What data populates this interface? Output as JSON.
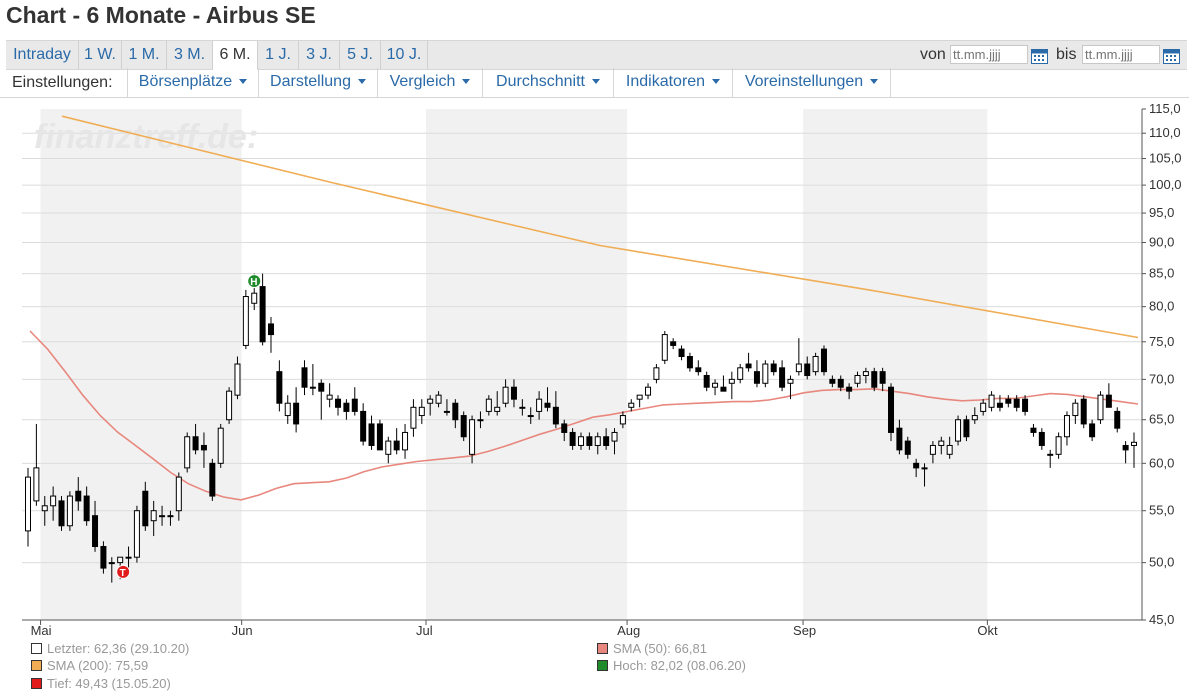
{
  "page": {
    "title": "Chart - 6 Monate - Airbus SE"
  },
  "tabs": [
    {
      "label": "Intraday"
    },
    {
      "label": "1 W."
    },
    {
      "label": "1 M."
    },
    {
      "label": "3 M."
    },
    {
      "label": "6 M.",
      "active": true
    },
    {
      "label": "1 J."
    },
    {
      "label": "3 J."
    },
    {
      "label": "5 J."
    },
    {
      "label": "10 J."
    }
  ],
  "date_range": {
    "from_label": "von",
    "from_placeholder": "tt.mm.jjjj",
    "to_label": "bis",
    "to_placeholder": "tt.mm.jjjj"
  },
  "settings": {
    "label": "Einstellungen:",
    "menus": [
      {
        "label": "Börsenplätze"
      },
      {
        "label": "Darstellung"
      },
      {
        "label": "Vergleich"
      },
      {
        "label": "Durchschnitt"
      },
      {
        "label": "Indikatoren"
      },
      {
        "label": "Voreinstellungen"
      }
    ]
  },
  "watermark": "finanztreff.de:",
  "colors": {
    "candle_up": "#ffffff",
    "candle_down": "#000000",
    "sma50": "#e8877d",
    "sma200": "#f0ad55",
    "band": "#f1f1f1",
    "grid": "#dcdcdc",
    "tab_link": "#2a6aa8",
    "marker_high": "#1f8b2b",
    "marker_low": "#e11b1b"
  },
  "chart_data": {
    "type": "candlestick",
    "y_scale": "log",
    "ylim": [
      45.0,
      115.0
    ],
    "y_ticks": [
      "115,0",
      "110,0",
      "105,0",
      "100,0",
      "95,0",
      "90,0",
      "85,0",
      "80,0",
      "75,0",
      "70,0",
      "65,0",
      "60,0",
      "55,0",
      "50,0",
      "45,0"
    ],
    "x_labels": [
      "Mai",
      "Jun",
      "Jul",
      "Aug",
      "Sep",
      "Okt"
    ],
    "candles": [
      {
        "o": 53.0,
        "h": 59.5,
        "l": 51.5,
        "c": 58.5
      },
      {
        "o": 56.0,
        "h": 64.5,
        "l": 55.5,
        "c": 59.5
      },
      {
        "o": 55.0,
        "h": 56.5,
        "l": 53.5,
        "c": 55.5
      },
      {
        "o": 55.5,
        "h": 57.5,
        "l": 54.0,
        "c": 56.5
      },
      {
        "o": 56.0,
        "h": 56.5,
        "l": 53.0,
        "c": 53.5
      },
      {
        "o": 53.5,
        "h": 57.0,
        "l": 53.0,
        "c": 56.5
      },
      {
        "o": 57.0,
        "h": 58.5,
        "l": 55.0,
        "c": 56.0
      },
      {
        "o": 56.5,
        "h": 57.5,
        "l": 53.5,
        "c": 54.0
      },
      {
        "o": 54.5,
        "h": 56.0,
        "l": 51.0,
        "c": 51.5
      },
      {
        "o": 51.5,
        "h": 52.0,
        "l": 49.0,
        "c": 49.5
      },
      {
        "o": 50.0,
        "h": 50.5,
        "l": 48.2,
        "c": 50.0
      },
      {
        "o": 50.0,
        "h": 50.5,
        "l": 48.5,
        "c": 50.5
      },
      {
        "o": 50.5,
        "h": 51.5,
        "l": 49.5,
        "c": 50.5
      },
      {
        "o": 50.5,
        "h": 55.5,
        "l": 50.0,
        "c": 55.0
      },
      {
        "o": 57.0,
        "h": 58.0,
        "l": 53.0,
        "c": 53.5
      },
      {
        "o": 54.0,
        "h": 56.0,
        "l": 52.5,
        "c": 55.0
      },
      {
        "o": 54.5,
        "h": 55.5,
        "l": 53.5,
        "c": 54.5
      },
      {
        "o": 54.5,
        "h": 55.0,
        "l": 53.5,
        "c": 54.5
      },
      {
        "o": 55.0,
        "h": 59.0,
        "l": 54.0,
        "c": 58.5
      },
      {
        "o": 59.5,
        "h": 63.5,
        "l": 59.0,
        "c": 63.0
      },
      {
        "o": 63.0,
        "h": 64.5,
        "l": 61.0,
        "c": 61.5
      },
      {
        "o": 62.0,
        "h": 63.5,
        "l": 59.5,
        "c": 61.5
      },
      {
        "o": 60.0,
        "h": 60.5,
        "l": 56.0,
        "c": 56.5
      },
      {
        "o": 60.0,
        "h": 64.5,
        "l": 59.5,
        "c": 64.0
      },
      {
        "o": 65.0,
        "h": 69.0,
        "l": 64.5,
        "c": 68.5
      },
      {
        "o": 68.0,
        "h": 73.0,
        "l": 67.5,
        "c": 72.0
      },
      {
        "o": 74.5,
        "h": 82.5,
        "l": 74.0,
        "c": 81.5
      },
      {
        "o": 80.5,
        "h": 85.0,
        "l": 79.5,
        "c": 82.0
      },
      {
        "o": 83.0,
        "h": 85.0,
        "l": 74.5,
        "c": 75.0
      },
      {
        "o": 77.5,
        "h": 78.5,
        "l": 73.5,
        "c": 76.0
      },
      {
        "o": 71.0,
        "h": 72.5,
        "l": 66.0,
        "c": 67.0
      },
      {
        "o": 65.5,
        "h": 68.0,
        "l": 64.5,
        "c": 67.0
      },
      {
        "o": 67.0,
        "h": 69.0,
        "l": 63.5,
        "c": 64.5
      },
      {
        "o": 71.5,
        "h": 72.5,
        "l": 68.0,
        "c": 69.0
      },
      {
        "o": 69.0,
        "h": 72.0,
        "l": 68.0,
        "c": 69.0
      },
      {
        "o": 69.5,
        "h": 70.0,
        "l": 65.0,
        "c": 68.5
      },
      {
        "o": 67.5,
        "h": 69.5,
        "l": 66.5,
        "c": 68.0
      },
      {
        "o": 67.5,
        "h": 68.0,
        "l": 65.5,
        "c": 66.5
      },
      {
        "o": 67.0,
        "h": 67.5,
        "l": 65.0,
        "c": 66.0
      },
      {
        "o": 67.5,
        "h": 69.0,
        "l": 65.5,
        "c": 66.0
      },
      {
        "o": 66.0,
        "h": 67.0,
        "l": 62.0,
        "c": 62.5
      },
      {
        "o": 64.5,
        "h": 65.5,
        "l": 61.5,
        "c": 62.0
      },
      {
        "o": 64.5,
        "h": 65.0,
        "l": 61.5,
        "c": 61.5
      },
      {
        "o": 61.0,
        "h": 63.0,
        "l": 60.0,
        "c": 62.5
      },
      {
        "o": 62.5,
        "h": 64.0,
        "l": 61.0,
        "c": 61.5
      },
      {
        "o": 61.5,
        "h": 64.5,
        "l": 60.5,
        "c": 63.5
      },
      {
        "o": 64.0,
        "h": 67.5,
        "l": 63.0,
        "c": 66.5
      },
      {
        "o": 65.5,
        "h": 67.5,
        "l": 64.5,
        "c": 66.5
      },
      {
        "o": 67.0,
        "h": 68.0,
        "l": 65.5,
        "c": 67.5
      },
      {
        "o": 67.0,
        "h": 68.5,
        "l": 66.5,
        "c": 68.0
      },
      {
        "o": 66.0,
        "h": 67.5,
        "l": 65.5,
        "c": 66.0
      },
      {
        "o": 67.0,
        "h": 67.5,
        "l": 64.0,
        "c": 65.0
      },
      {
        "o": 65.5,
        "h": 66.0,
        "l": 62.5,
        "c": 63.0
      },
      {
        "o": 61.0,
        "h": 65.5,
        "l": 60.0,
        "c": 65.0
      },
      {
        "o": 65.0,
        "h": 66.0,
        "l": 64.0,
        "c": 65.0
      },
      {
        "o": 66.0,
        "h": 68.0,
        "l": 65.5,
        "c": 67.5
      },
      {
        "o": 66.0,
        "h": 68.5,
        "l": 65.5,
        "c": 66.5
      },
      {
        "o": 67.0,
        "h": 70.0,
        "l": 66.5,
        "c": 69.0
      },
      {
        "o": 69.0,
        "h": 70.0,
        "l": 66.5,
        "c": 67.5
      },
      {
        "o": 66.5,
        "h": 67.5,
        "l": 65.5,
        "c": 66.5
      },
      {
        "o": 65.5,
        "h": 66.5,
        "l": 64.5,
        "c": 65.5
      },
      {
        "o": 66.0,
        "h": 68.5,
        "l": 65.0,
        "c": 67.5
      },
      {
        "o": 67.0,
        "h": 69.0,
        "l": 66.0,
        "c": 66.5
      },
      {
        "o": 66.5,
        "h": 68.5,
        "l": 64.0,
        "c": 64.5
      },
      {
        "o": 64.5,
        "h": 65.0,
        "l": 62.5,
        "c": 63.5
      },
      {
        "o": 63.5,
        "h": 64.0,
        "l": 61.5,
        "c": 62.0
      },
      {
        "o": 62.0,
        "h": 63.5,
        "l": 61.5,
        "c": 63.0
      },
      {
        "o": 63.0,
        "h": 63.5,
        "l": 61.5,
        "c": 62.0
      },
      {
        "o": 62.0,
        "h": 63.5,
        "l": 61.0,
        "c": 63.0
      },
      {
        "o": 63.0,
        "h": 64.0,
        "l": 61.5,
        "c": 62.0
      },
      {
        "o": 62.5,
        "h": 64.0,
        "l": 61.0,
        "c": 63.5
      },
      {
        "o": 64.5,
        "h": 66.0,
        "l": 64.0,
        "c": 65.5
      },
      {
        "o": 66.5,
        "h": 67.5,
        "l": 66.0,
        "c": 67.0
      },
      {
        "o": 67.5,
        "h": 68.0,
        "l": 66.5,
        "c": 68.0
      },
      {
        "o": 68.0,
        "h": 69.5,
        "l": 67.5,
        "c": 69.0
      },
      {
        "o": 70.0,
        "h": 72.0,
        "l": 69.5,
        "c": 71.5
      },
      {
        "o": 72.5,
        "h": 76.5,
        "l": 72.0,
        "c": 76.0
      },
      {
        "o": 75.0,
        "h": 75.5,
        "l": 74.0,
        "c": 74.5
      },
      {
        "o": 74.0,
        "h": 74.5,
        "l": 72.5,
        "c": 73.0
      },
      {
        "o": 73.0,
        "h": 73.5,
        "l": 71.0,
        "c": 71.5
      },
      {
        "o": 71.5,
        "h": 72.5,
        "l": 70.5,
        "c": 71.0
      },
      {
        "o": 70.5,
        "h": 71.0,
        "l": 68.5,
        "c": 69.0
      },
      {
        "o": 69.0,
        "h": 70.0,
        "l": 68.0,
        "c": 69.5
      },
      {
        "o": 69.0,
        "h": 70.5,
        "l": 68.5,
        "c": 68.5
      },
      {
        "o": 69.5,
        "h": 71.0,
        "l": 67.5,
        "c": 70.0
      },
      {
        "o": 70.0,
        "h": 72.0,
        "l": 69.5,
        "c": 71.5
      },
      {
        "o": 72.0,
        "h": 73.5,
        "l": 71.0,
        "c": 71.5
      },
      {
        "o": 71.0,
        "h": 72.5,
        "l": 69.0,
        "c": 69.5
      },
      {
        "o": 69.5,
        "h": 72.5,
        "l": 69.0,
        "c": 72.0
      },
      {
        "o": 72.0,
        "h": 72.5,
        "l": 70.5,
        "c": 71.0
      },
      {
        "o": 71.5,
        "h": 72.5,
        "l": 68.5,
        "c": 69.0
      },
      {
        "o": 69.5,
        "h": 70.5,
        "l": 67.5,
        "c": 70.0
      },
      {
        "o": 71.0,
        "h": 75.5,
        "l": 70.5,
        "c": 72.0
      },
      {
        "o": 72.0,
        "h": 73.0,
        "l": 70.0,
        "c": 70.5
      },
      {
        "o": 71.0,
        "h": 73.5,
        "l": 70.5,
        "c": 73.0
      },
      {
        "o": 74.0,
        "h": 74.5,
        "l": 70.5,
        "c": 71.0
      },
      {
        "o": 70.0,
        "h": 70.5,
        "l": 69.0,
        "c": 69.5
      },
      {
        "o": 70.0,
        "h": 70.5,
        "l": 68.5,
        "c": 69.0
      },
      {
        "o": 69.0,
        "h": 69.5,
        "l": 67.5,
        "c": 68.5
      },
      {
        "o": 69.5,
        "h": 71.0,
        "l": 69.0,
        "c": 70.5
      },
      {
        "o": 70.5,
        "h": 71.5,
        "l": 69.5,
        "c": 71.0
      },
      {
        "o": 71.0,
        "h": 71.5,
        "l": 68.5,
        "c": 69.0
      },
      {
        "o": 71.0,
        "h": 71.5,
        "l": 68.5,
        "c": 69.5
      },
      {
        "o": 69.0,
        "h": 69.5,
        "l": 62.5,
        "c": 63.5
      },
      {
        "o": 64.0,
        "h": 65.0,
        "l": 61.0,
        "c": 61.5
      },
      {
        "o": 62.5,
        "h": 63.0,
        "l": 60.5,
        "c": 61.0
      },
      {
        "o": 60.0,
        "h": 60.5,
        "l": 58.5,
        "c": 59.5
      },
      {
        "o": 59.5,
        "h": 60.0,
        "l": 57.5,
        "c": 59.5
      },
      {
        "o": 61.0,
        "h": 62.5,
        "l": 60.0,
        "c": 62.0
      },
      {
        "o": 62.0,
        "h": 63.0,
        "l": 61.0,
        "c": 62.5
      },
      {
        "o": 61.0,
        "h": 63.0,
        "l": 60.5,
        "c": 62.0
      },
      {
        "o": 62.5,
        "h": 65.5,
        "l": 62.0,
        "c": 65.0
      },
      {
        "o": 65.0,
        "h": 65.5,
        "l": 62.5,
        "c": 63.0
      },
      {
        "o": 65.0,
        "h": 66.5,
        "l": 64.5,
        "c": 65.5
      },
      {
        "o": 66.0,
        "h": 67.5,
        "l": 65.5,
        "c": 67.0
      },
      {
        "o": 66.5,
        "h": 68.5,
        "l": 66.0,
        "c": 68.0
      },
      {
        "o": 67.0,
        "h": 68.0,
        "l": 66.0,
        "c": 66.5
      },
      {
        "o": 67.5,
        "h": 68.0,
        "l": 66.5,
        "c": 67.0
      },
      {
        "o": 67.5,
        "h": 68.0,
        "l": 66.0,
        "c": 66.5
      },
      {
        "o": 67.5,
        "h": 68.0,
        "l": 65.5,
        "c": 66.0
      },
      {
        "o": 64.0,
        "h": 64.5,
        "l": 63.0,
        "c": 63.5
      },
      {
        "o": 63.5,
        "h": 64.0,
        "l": 61.5,
        "c": 62.0
      },
      {
        "o": 61.0,
        "h": 61.5,
        "l": 59.5,
        "c": 61.0
      },
      {
        "o": 61.0,
        "h": 63.5,
        "l": 60.5,
        "c": 63.0
      },
      {
        "o": 63.0,
        "h": 66.0,
        "l": 62.0,
        "c": 65.5
      },
      {
        "o": 65.5,
        "h": 67.5,
        "l": 64.5,
        "c": 67.0
      },
      {
        "o": 67.5,
        "h": 68.0,
        "l": 64.0,
        "c": 64.5
      },
      {
        "o": 64.5,
        "h": 65.0,
        "l": 62.5,
        "c": 63.0
      },
      {
        "o": 65.0,
        "h": 68.5,
        "l": 64.5,
        "c": 68.0
      },
      {
        "o": 68.0,
        "h": 69.5,
        "l": 66.5,
        "c": 66.5
      },
      {
        "o": 66.0,
        "h": 66.5,
        "l": 63.5,
        "c": 64.0
      },
      {
        "o": 62.0,
        "h": 62.5,
        "l": 60.0,
        "c": 61.5
      },
      {
        "o": 62.0,
        "h": 63.5,
        "l": 59.5,
        "c": 62.36
      }
    ],
    "sma50": [
      76.5,
      74.0,
      71.0,
      68.0,
      65.5,
      63.5,
      62.0,
      60.5,
      59.0,
      57.8,
      57.0,
      56.4,
      56.1,
      56.6,
      57.3,
      57.8,
      57.9,
      58.0,
      58.4,
      59.1,
      59.6,
      59.9,
      60.2,
      60.4,
      60.6,
      60.8,
      61.3,
      61.9,
      62.6,
      63.3,
      63.9,
      64.6,
      65.3,
      65.6,
      66.0,
      66.4,
      66.8,
      66.9,
      67.0,
      67.1,
      67.2,
      67.2,
      67.4,
      67.8,
      68.3,
      68.6,
      68.7,
      68.7,
      68.8,
      68.5,
      68.2,
      67.8,
      67.5,
      67.3,
      67.4,
      67.6,
      67.6,
      67.9,
      68.2,
      68.1,
      67.8,
      67.5,
      67.2,
      66.9
    ],
    "sma200": [
      113.5,
      100.5,
      89.5,
      82.5,
      75.59
    ],
    "x_label_candle_index": [
      2,
      26,
      48,
      72,
      93,
      115
    ],
    "band_ranges": [
      [
        2,
        26
      ],
      [
        48,
        72
      ],
      [
        93,
        115
      ]
    ],
    "markers": {
      "high": {
        "label": "H",
        "candle": 27,
        "value": 82.02
      },
      "low": {
        "label": "T",
        "candle": 11,
        "value": 49.43
      }
    }
  },
  "legend": {
    "last": "Letzter: 62,36 (29.10.20)",
    "sma200": "SMA (200): 75,59",
    "low": "Tief: 49,43 (15.05.20)",
    "sma50": "SMA (50): 66,81",
    "high": "Hoch: 82,02 (08.06.20)"
  }
}
